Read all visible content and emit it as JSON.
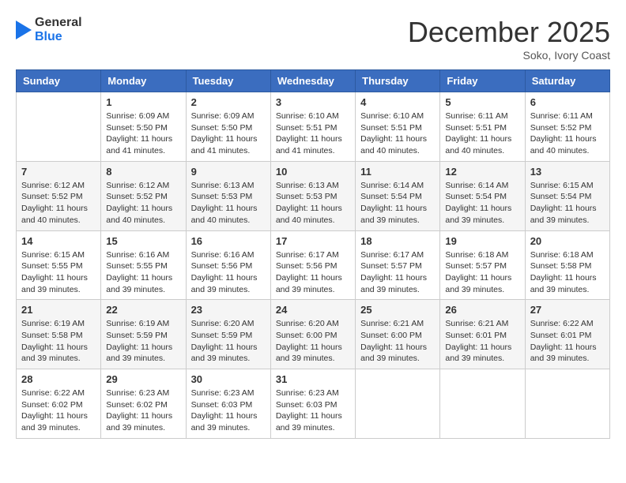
{
  "header": {
    "logo": {
      "general": "General",
      "blue": "Blue"
    },
    "title": "December 2025",
    "location": "Soko, Ivory Coast"
  },
  "calendar": {
    "days_of_week": [
      "Sunday",
      "Monday",
      "Tuesday",
      "Wednesday",
      "Thursday",
      "Friday",
      "Saturday"
    ],
    "weeks": [
      [
        {
          "day": "",
          "sunrise": "",
          "sunset": "",
          "daylight": ""
        },
        {
          "day": "1",
          "sunrise": "Sunrise: 6:09 AM",
          "sunset": "Sunset: 5:50 PM",
          "daylight": "Daylight: 11 hours and 41 minutes."
        },
        {
          "day": "2",
          "sunrise": "Sunrise: 6:09 AM",
          "sunset": "Sunset: 5:50 PM",
          "daylight": "Daylight: 11 hours and 41 minutes."
        },
        {
          "day": "3",
          "sunrise": "Sunrise: 6:10 AM",
          "sunset": "Sunset: 5:51 PM",
          "daylight": "Daylight: 11 hours and 41 minutes."
        },
        {
          "day": "4",
          "sunrise": "Sunrise: 6:10 AM",
          "sunset": "Sunset: 5:51 PM",
          "daylight": "Daylight: 11 hours and 40 minutes."
        },
        {
          "day": "5",
          "sunrise": "Sunrise: 6:11 AM",
          "sunset": "Sunset: 5:51 PM",
          "daylight": "Daylight: 11 hours and 40 minutes."
        },
        {
          "day": "6",
          "sunrise": "Sunrise: 6:11 AM",
          "sunset": "Sunset: 5:52 PM",
          "daylight": "Daylight: 11 hours and 40 minutes."
        }
      ],
      [
        {
          "day": "7",
          "sunrise": "Sunrise: 6:12 AM",
          "sunset": "Sunset: 5:52 PM",
          "daylight": "Daylight: 11 hours and 40 minutes."
        },
        {
          "day": "8",
          "sunrise": "Sunrise: 6:12 AM",
          "sunset": "Sunset: 5:52 PM",
          "daylight": "Daylight: 11 hours and 40 minutes."
        },
        {
          "day": "9",
          "sunrise": "Sunrise: 6:13 AM",
          "sunset": "Sunset: 5:53 PM",
          "daylight": "Daylight: 11 hours and 40 minutes."
        },
        {
          "day": "10",
          "sunrise": "Sunrise: 6:13 AM",
          "sunset": "Sunset: 5:53 PM",
          "daylight": "Daylight: 11 hours and 40 minutes."
        },
        {
          "day": "11",
          "sunrise": "Sunrise: 6:14 AM",
          "sunset": "Sunset: 5:54 PM",
          "daylight": "Daylight: 11 hours and 39 minutes."
        },
        {
          "day": "12",
          "sunrise": "Sunrise: 6:14 AM",
          "sunset": "Sunset: 5:54 PM",
          "daylight": "Daylight: 11 hours and 39 minutes."
        },
        {
          "day": "13",
          "sunrise": "Sunrise: 6:15 AM",
          "sunset": "Sunset: 5:54 PM",
          "daylight": "Daylight: 11 hours and 39 minutes."
        }
      ],
      [
        {
          "day": "14",
          "sunrise": "Sunrise: 6:15 AM",
          "sunset": "Sunset: 5:55 PM",
          "daylight": "Daylight: 11 hours and 39 minutes."
        },
        {
          "day": "15",
          "sunrise": "Sunrise: 6:16 AM",
          "sunset": "Sunset: 5:55 PM",
          "daylight": "Daylight: 11 hours and 39 minutes."
        },
        {
          "day": "16",
          "sunrise": "Sunrise: 6:16 AM",
          "sunset": "Sunset: 5:56 PM",
          "daylight": "Daylight: 11 hours and 39 minutes."
        },
        {
          "day": "17",
          "sunrise": "Sunrise: 6:17 AM",
          "sunset": "Sunset: 5:56 PM",
          "daylight": "Daylight: 11 hours and 39 minutes."
        },
        {
          "day": "18",
          "sunrise": "Sunrise: 6:17 AM",
          "sunset": "Sunset: 5:57 PM",
          "daylight": "Daylight: 11 hours and 39 minutes."
        },
        {
          "day": "19",
          "sunrise": "Sunrise: 6:18 AM",
          "sunset": "Sunset: 5:57 PM",
          "daylight": "Daylight: 11 hours and 39 minutes."
        },
        {
          "day": "20",
          "sunrise": "Sunrise: 6:18 AM",
          "sunset": "Sunset: 5:58 PM",
          "daylight": "Daylight: 11 hours and 39 minutes."
        }
      ],
      [
        {
          "day": "21",
          "sunrise": "Sunrise: 6:19 AM",
          "sunset": "Sunset: 5:58 PM",
          "daylight": "Daylight: 11 hours and 39 minutes."
        },
        {
          "day": "22",
          "sunrise": "Sunrise: 6:19 AM",
          "sunset": "Sunset: 5:59 PM",
          "daylight": "Daylight: 11 hours and 39 minutes."
        },
        {
          "day": "23",
          "sunrise": "Sunrise: 6:20 AM",
          "sunset": "Sunset: 5:59 PM",
          "daylight": "Daylight: 11 hours and 39 minutes."
        },
        {
          "day": "24",
          "sunrise": "Sunrise: 6:20 AM",
          "sunset": "Sunset: 6:00 PM",
          "daylight": "Daylight: 11 hours and 39 minutes."
        },
        {
          "day": "25",
          "sunrise": "Sunrise: 6:21 AM",
          "sunset": "Sunset: 6:00 PM",
          "daylight": "Daylight: 11 hours and 39 minutes."
        },
        {
          "day": "26",
          "sunrise": "Sunrise: 6:21 AM",
          "sunset": "Sunset: 6:01 PM",
          "daylight": "Daylight: 11 hours and 39 minutes."
        },
        {
          "day": "27",
          "sunrise": "Sunrise: 6:22 AM",
          "sunset": "Sunset: 6:01 PM",
          "daylight": "Daylight: 11 hours and 39 minutes."
        }
      ],
      [
        {
          "day": "28",
          "sunrise": "Sunrise: 6:22 AM",
          "sunset": "Sunset: 6:02 PM",
          "daylight": "Daylight: 11 hours and 39 minutes."
        },
        {
          "day": "29",
          "sunrise": "Sunrise: 6:23 AM",
          "sunset": "Sunset: 6:02 PM",
          "daylight": "Daylight: 11 hours and 39 minutes."
        },
        {
          "day": "30",
          "sunrise": "Sunrise: 6:23 AM",
          "sunset": "Sunset: 6:03 PM",
          "daylight": "Daylight: 11 hours and 39 minutes."
        },
        {
          "day": "31",
          "sunrise": "Sunrise: 6:23 AM",
          "sunset": "Sunset: 6:03 PM",
          "daylight": "Daylight: 11 hours and 39 minutes."
        },
        {
          "day": "",
          "sunrise": "",
          "sunset": "",
          "daylight": ""
        },
        {
          "day": "",
          "sunrise": "",
          "sunset": "",
          "daylight": ""
        },
        {
          "day": "",
          "sunrise": "",
          "sunset": "",
          "daylight": ""
        }
      ]
    ]
  }
}
